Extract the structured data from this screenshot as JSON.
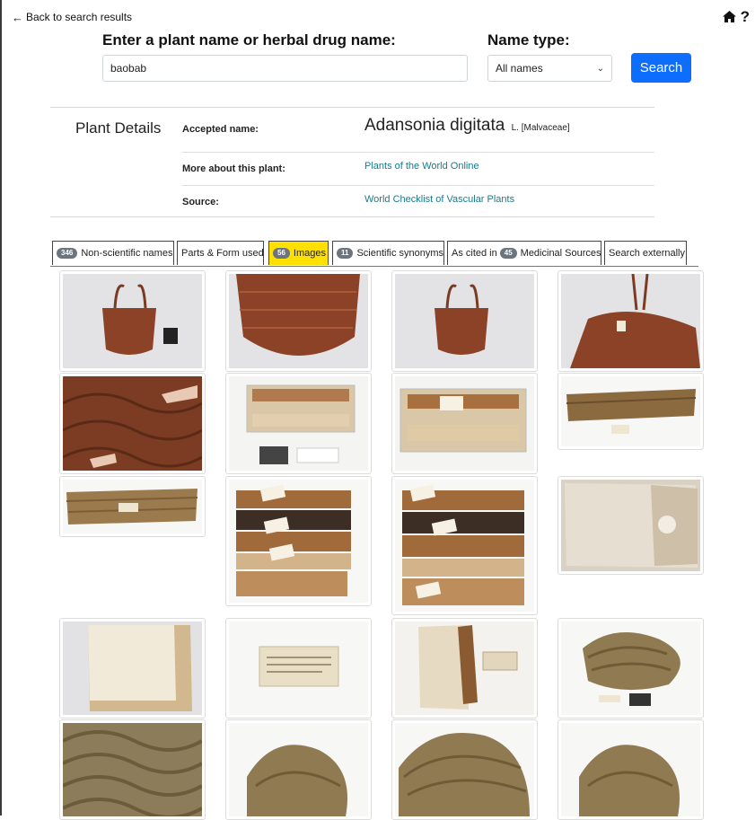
{
  "nav": {
    "back_label": "Back to search results"
  },
  "search": {
    "heading": "Enter a plant name or herbal drug name:",
    "value": "baobab",
    "name_type_heading": "Name type:",
    "name_type_selected": "All names",
    "button_label": "Search"
  },
  "details": {
    "title": "Plant Details",
    "accepted_label": "Accepted name:",
    "accepted_name": "Adansonia digitata",
    "author_family": "L. [Malvaceae]",
    "more_label": "More about this plant:",
    "more_link": "Plants of the World Online",
    "source_label": "Source:",
    "source_link": "World Checklist of Vascular Plants"
  },
  "tabs": [
    {
      "count": "346",
      "label": "Non-scientific names"
    },
    {
      "count": "",
      "label": "Parts & Form used"
    },
    {
      "count": "56",
      "label": "Images"
    },
    {
      "count": "11",
      "label": "Scientific synonyms"
    },
    {
      "prefix": "As cited in",
      "count": "45",
      "label": "Medicinal Sources"
    },
    {
      "count": "",
      "label": "Search externally"
    }
  ],
  "colors": {
    "primary_button": "#0d6efd",
    "active_tab": "#ffe000",
    "link": "#1a7a8a",
    "badge": "#6c757d"
  },
  "icons": [
    "arrow-left-icon",
    "home-icon",
    "help-icon"
  ]
}
